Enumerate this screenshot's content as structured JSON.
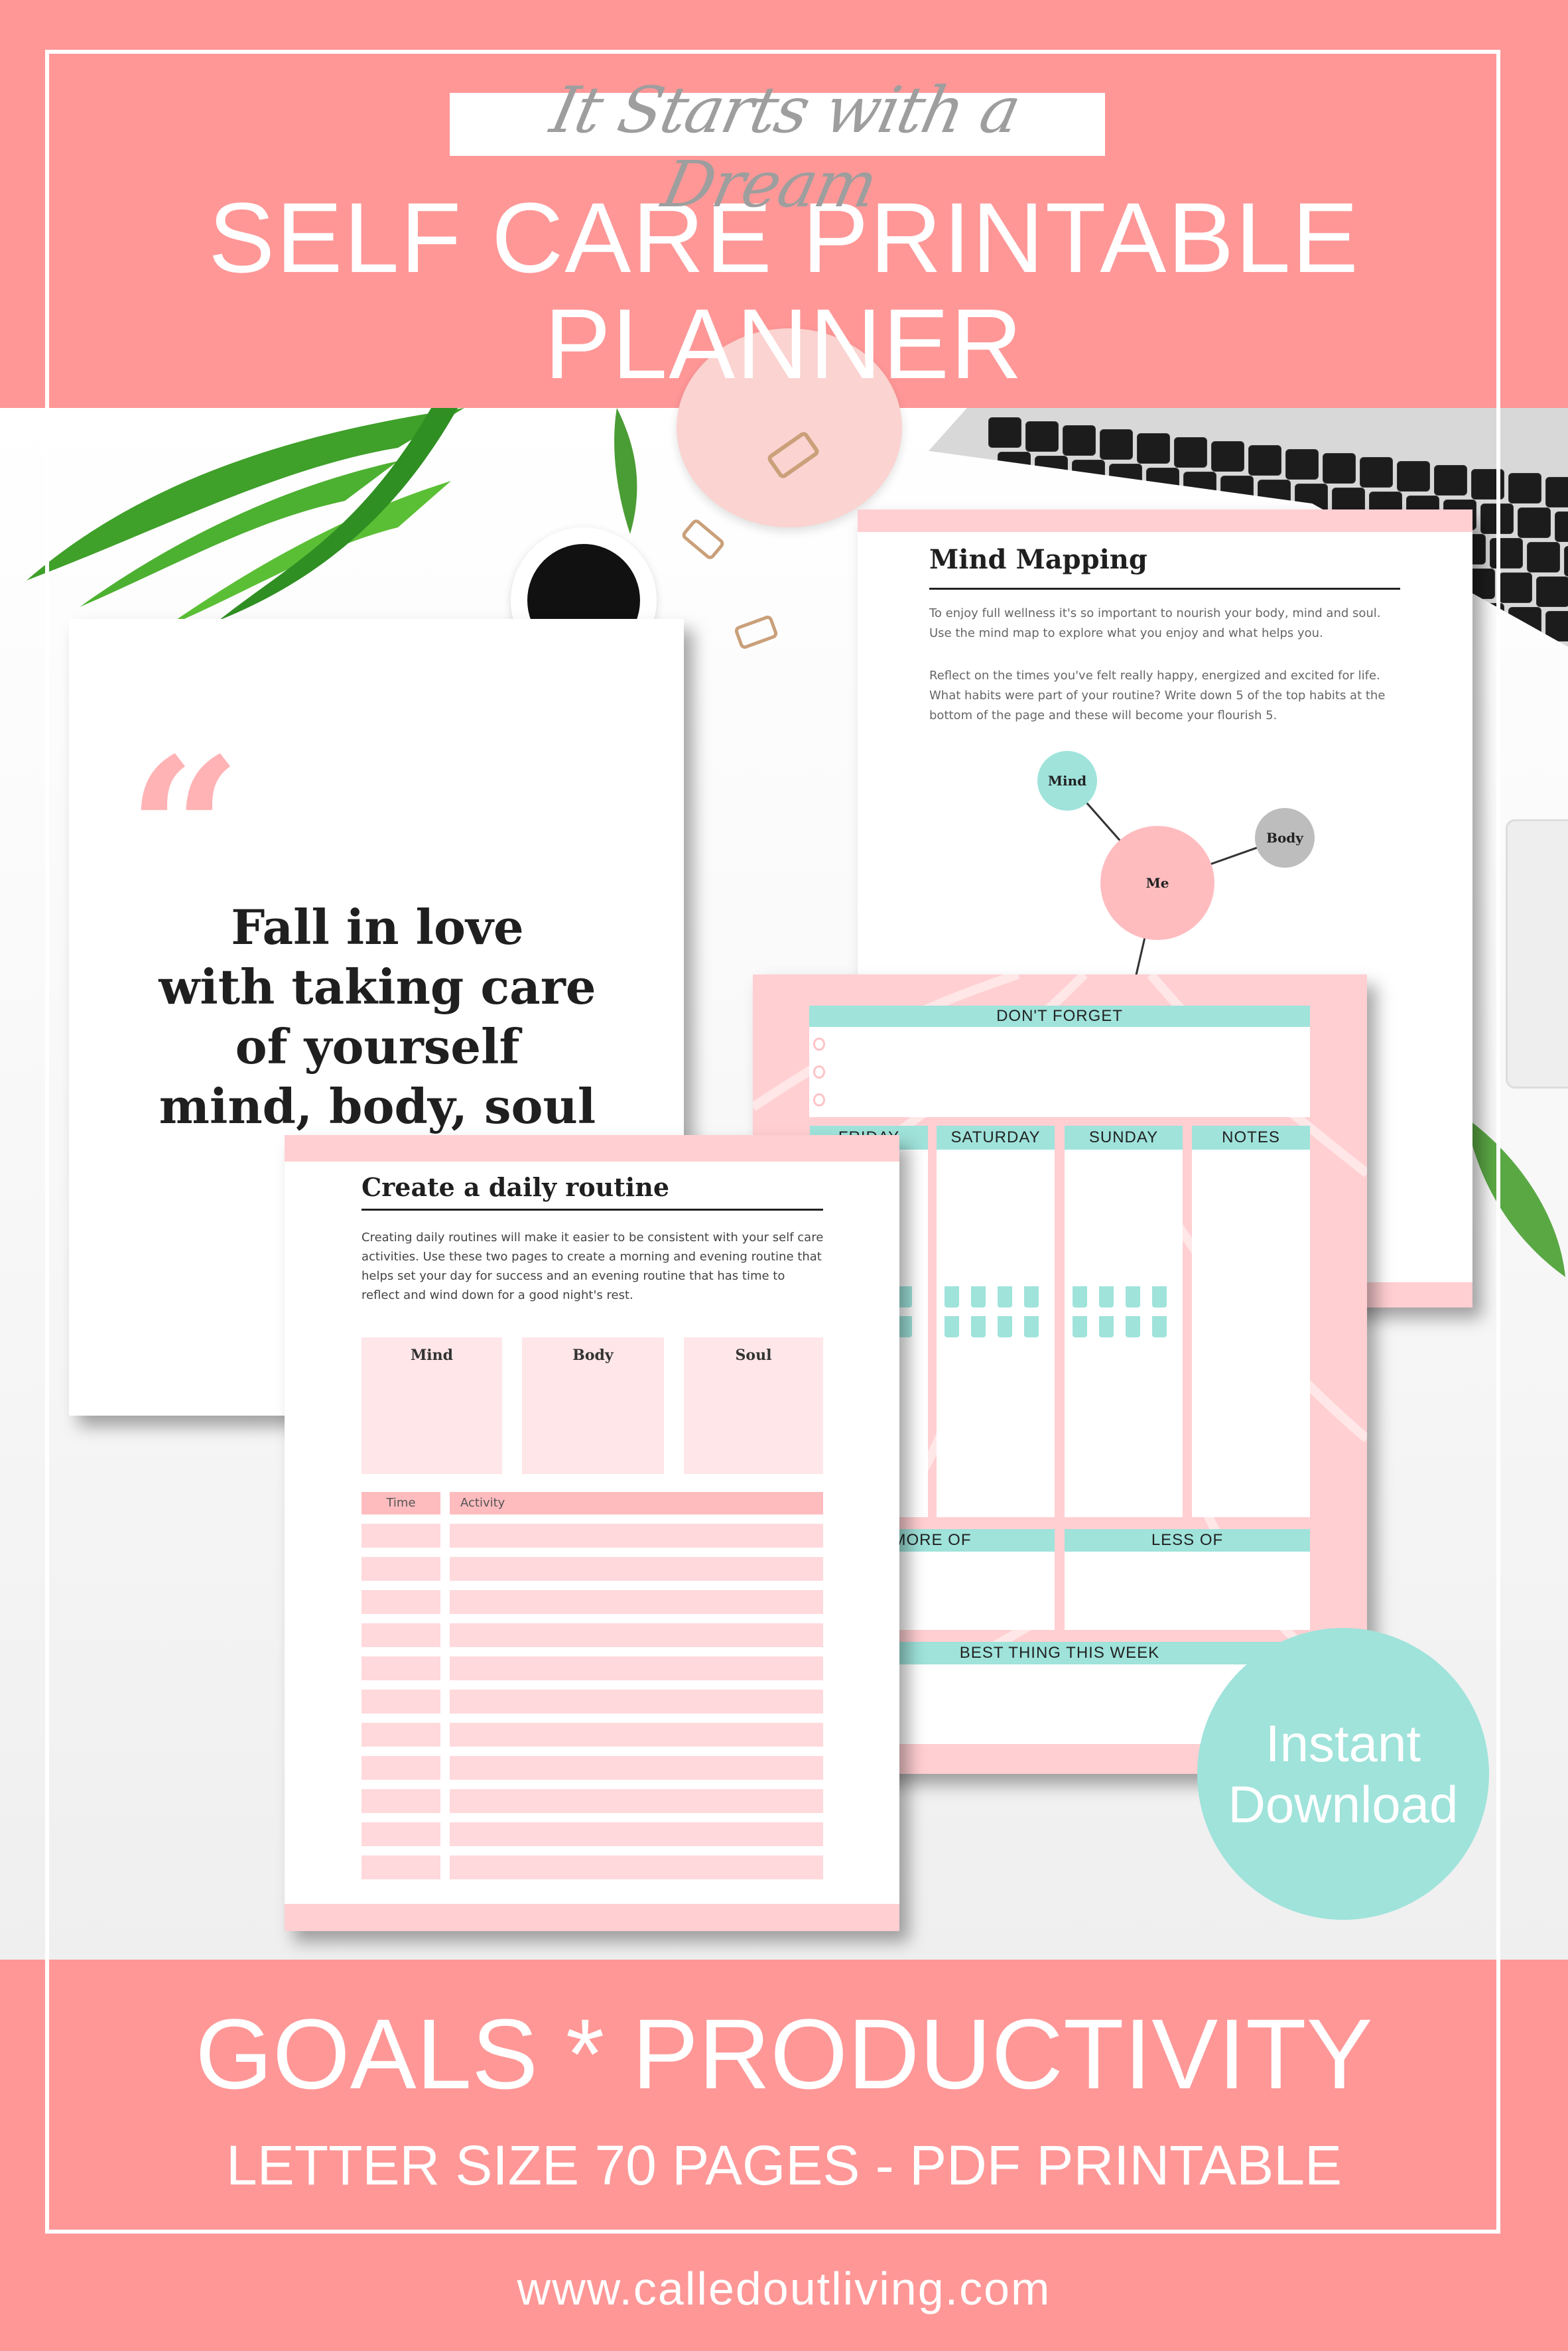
{
  "colors": {
    "banner_pink": "#ff9797",
    "light_pink": "#ffd0d3",
    "teal": "#9fe3db",
    "text_dark": "#1f1f1f",
    "script_grey": "#9e9e9e"
  },
  "header": {
    "script": "It Starts with a Dream",
    "title_lines": [
      "SELF CARE PRINTABLE",
      "PLANNER"
    ]
  },
  "quote_page": {
    "quote_icon": "quote-mark-icon",
    "lines": [
      "Fall in love",
      "with taking care",
      "of yourself",
      "mind, body, soul"
    ]
  },
  "mind_map_page": {
    "title": "Mind Mapping",
    "paragraphs": [
      "To enjoy full wellness it's so important to nourish your body, mind and soul. Use the mind map to explore what you enjoy and what helps you.",
      "Reflect on the times you've felt really happy, energized and excited for life. What habits were part of your routine? Write down 5 of the top habits at the bottom of the page and these will become your flourish 5."
    ],
    "nodes": {
      "mind": "Mind",
      "me": "Me",
      "body": "Body"
    }
  },
  "weekly_page": {
    "dont_forget": "DON'T FORGET",
    "days": [
      "FRIDAY",
      "SATURDAY",
      "SUNDAY",
      "NOTES"
    ],
    "more_of": "MORE OF",
    "less_of": "LESS OF",
    "best_thing": "BEST THING THIS WEEK",
    "water_icon": "water-glass-icon"
  },
  "routine_page": {
    "title": "Create a daily routine",
    "paragraph": "Creating daily routines will make it easier to be consistent with your self care activities. Use these two pages to create a morning and evening routine that helps set your day for success and an evening routine that has time to reflect and wind down for a good night's rest.",
    "boxes": [
      "Mind",
      "Body",
      "Soul"
    ],
    "table": {
      "time_header": "Time",
      "activity_header": "Activity"
    }
  },
  "badge": {
    "line1": "Instant",
    "line2": "Download"
  },
  "footer": {
    "tagline": "GOALS * PRODUCTIVITY",
    "subline": "LETTER  SIZE 70 PAGES - PDF PRINTABLE",
    "url": "www.calledoutliving.com"
  }
}
